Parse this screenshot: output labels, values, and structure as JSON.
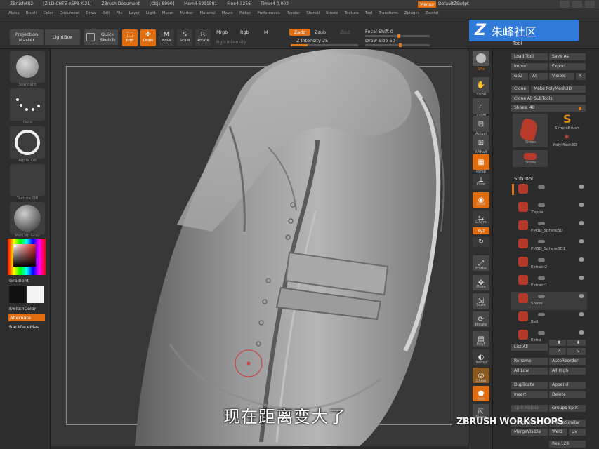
{
  "titlebar": {
    "app": "ZBrush4R2",
    "file": "[ZILD CHTE-ASP3-K-21]",
    "doc": "ZBrush Document",
    "objs": "[Objs 8990]",
    "mem": "Mem4 6991581",
    "free": "Free4 3256",
    "timer": "Timer4 0.002",
    "menus_label": "Menus",
    "script_label": "DefaultZScript"
  },
  "menubar": {
    "items": [
      "Alpha",
      "Brush",
      "Color",
      "Document",
      "Draw",
      "Edit",
      "File",
      "Layer",
      "Light",
      "Macro",
      "Marker",
      "Material",
      "Movie",
      "Picker",
      "Preferences",
      "Render",
      "Stencil",
      "Stroke",
      "Texture",
      "Tool",
      "Transform",
      "Zplugin",
      "Zscript"
    ]
  },
  "toolbar": {
    "projection_master": "Projection\nMaster",
    "lightbox": "LightBox",
    "quick_sketch": "Quick\nSketch",
    "edit": "Edit",
    "draw": "Draw",
    "move": "Move",
    "scale": "Scale",
    "rotate": "Rotate",
    "mrgb": "Mrgb",
    "rgb": "Rgb",
    "m": "M",
    "rgb_intensity": "Rgb Intensity",
    "zadd": "Zadd",
    "zsub": "Zsub",
    "zcut": "Zcut",
    "z_intensity": "Z Intensity 25",
    "focal_shift": "Focal Shift 0",
    "draw_size": "Draw Size 50",
    "z_intensity_value": 25,
    "draw_size_value": 50
  },
  "left": {
    "brush_caption": "Standard",
    "stroke_caption": "Dots",
    "alpha_caption": "Alpha Off",
    "texture_caption": "Texture Off",
    "material_caption": "MatCap Gray",
    "gradient": "Gradient",
    "switch_color": "SwitchColor",
    "alternate": "Alternate",
    "backface": "BackfaceMas"
  },
  "shelf": {
    "bpr": "BPR",
    "spix": "SPix",
    "scroll": "Scroll",
    "zoom": "Zoom",
    "actual": "Actual",
    "aahalf": "AAHalf",
    "persp": "Persp",
    "floor": "Floor",
    "local": "Local",
    "lsym": "L.Sym",
    "xyz": "Xyz",
    "frame": "Frame",
    "move": "Move",
    "scale": "Scale",
    "rotate": "Rotate",
    "polyf": "PolyF",
    "transp": "Transp",
    "ghost": "Ghost",
    "solo": "Solo",
    "xpose": "Xpose"
  },
  "tool": {
    "title": "Tool",
    "load_tool": "Load Tool",
    "save_as": "Save As",
    "import": "Import",
    "export": "Export",
    "goz": "GoZ",
    "all": "All",
    "visible": "Visible",
    "r": "R",
    "clone": "Clone",
    "make_polymesh": "Make PolyMesh3D",
    "clone_all": "Clone All SubTools",
    "shoes_slider": "Shoes. 48",
    "thumb_shoes": "Shoes",
    "simplebrush": "SimpleBrush",
    "polymesh3d": "PolyMesh3D",
    "thumb_shoes2": "Shoes",
    "subtool_header": "SubTool",
    "subtools": [
      "",
      "Zeppa",
      "PM3D_Sphere3D",
      "PM3D_Sphere3D1",
      "Extract2",
      "Extract1",
      "Shoes",
      "Belt",
      "Extra"
    ],
    "list_all": "List All",
    "rename": "Rename",
    "autoreorder": "AutoReorder",
    "all_low": "All Low",
    "all_high": "All High",
    "duplicate": "Duplicate",
    "append": "Append",
    "insert": "Insert",
    "delete": "Delete",
    "split_hidden": "Split Hidden",
    "groups_split": "Groups Split",
    "merge_down": "MergeDown",
    "merge_similar": "MergeSimilar",
    "merge_visible": "MergeVisible",
    "weld": "Weld",
    "uv": "Uv",
    "res": "Res 128"
  },
  "overlay": {
    "watermark_text": "朱峰社区",
    "subtitle": "现在距离变大了",
    "brand": "ZBRUSH WORKSHOPS"
  }
}
